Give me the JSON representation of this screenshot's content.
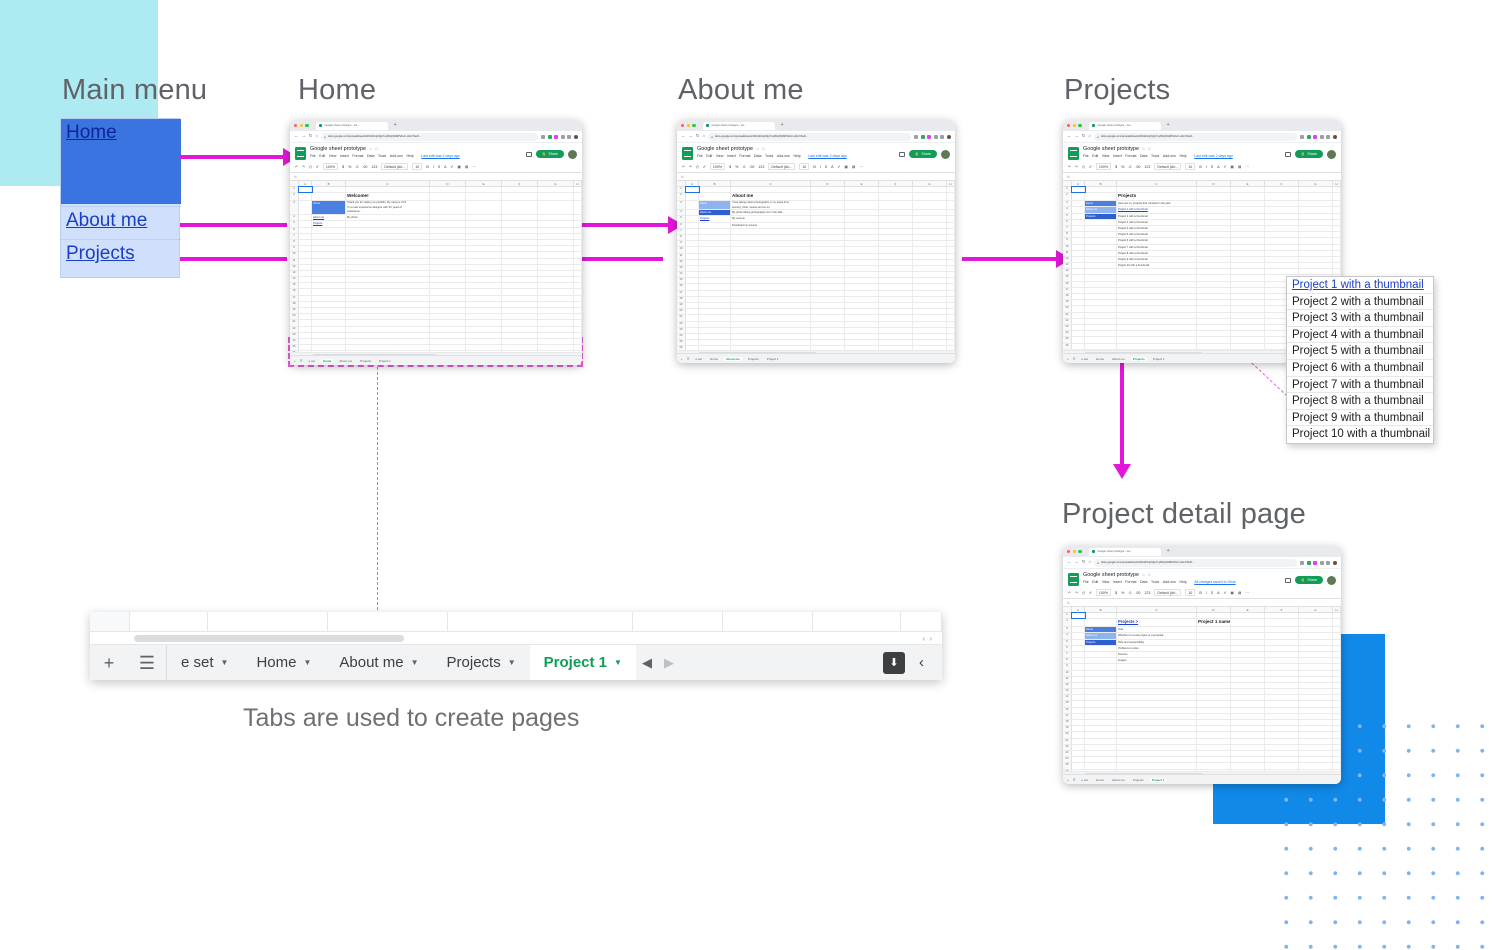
{
  "headings": {
    "main_menu": "Main menu",
    "home": "Home",
    "about_me": "About me",
    "projects": "Projects",
    "project_detail": "Project detail page"
  },
  "caption": {
    "tabs": "Tabs are used to create pages"
  },
  "main_menu": {
    "items": [
      {
        "label": "Home",
        "state": "selected"
      },
      {
        "label": "About me",
        "state": "normal"
      },
      {
        "label": "Projects",
        "state": "normal"
      }
    ]
  },
  "browser": {
    "tab_title": "Google sheet prototype - Go...",
    "new_tab": "+",
    "back": "←",
    "forward": "→",
    "reload": "↻",
    "home": "⌂",
    "lock": "●",
    "url": "docs.google.com/spreadsheets/d/1hkDmj0Ujp7uy8GQNx6RVAvC-s0mXbeD...",
    "star": "☆",
    "menu": "⋮"
  },
  "doc": {
    "title": "Google sheet prototype",
    "star": "☆",
    "drive": "□",
    "menus": [
      "File",
      "Edit",
      "View",
      "Insert",
      "Format",
      "Data",
      "Tools",
      "Add-ons",
      "Help"
    ],
    "last_edit": "Last edit was 2 days ago",
    "last_edit_saved": "All changes saved to Drive",
    "share": "Share",
    "share_icon": "🔒",
    "comment_icon": "comment",
    "toolbar": {
      "undo": "↶",
      "redo": "↷",
      "print": "⎙",
      "paint": "✐",
      "zoom": "100%",
      "currency": "$",
      "percent": "%",
      "decimal_dec": ".0",
      "decimal_inc": ".00",
      "format": "123",
      "font": "Default (Ari...",
      "font_size": "10",
      "bold": "B",
      "italic": "I",
      "strike": "S",
      "text_color": "A",
      "fill": "✐",
      "borders": "▦",
      "merge": "▤",
      "more": "⋯",
      "collapse": "⌃"
    },
    "formula_bar": "fx"
  },
  "sheet_tabs": {
    "add": "+",
    "all_sheets": "☰",
    "tabs": [
      "e set",
      "Home",
      "About me",
      "Projects",
      "Project 1"
    ],
    "active": "Project 1",
    "prev": "◀",
    "next": "▶",
    "all_sheets_button": "⬇",
    "collapse": "‹",
    "truncated_first": "e set"
  },
  "home_page": {
    "heading": "Welcome!",
    "nav": [
      "Home",
      "About me",
      "Projects"
    ],
    "body": [
      "Thank you for visiting my portfolio. My name is XYZ.",
      "I'm a user experience designer with XX years of",
      "experience."
    ],
    "photo_label": "My photo"
  },
  "about_page": {
    "heading": "About me",
    "nav": [
      "Home",
      "About me",
      "Projects"
    ],
    "rows": [
      "I love taking nature photography in my spare time,",
      "scenery, birds, insects and so on.",
      "My photo taking photography out in the wild...",
      "My resume",
      "Download my resume"
    ]
  },
  "projects_page": {
    "heading": "Projects",
    "nav": [
      "Home",
      "About me",
      "Projects"
    ],
    "intro": "Here are my projects that I worked in the past",
    "items": [
      "Project 1 with a thumbnail",
      "Project 2 with a thumbnail",
      "Project 3 with a thumbnail",
      "Project 4 with a thumbnail",
      "Project 5 with a thumbnail",
      "Project 6 with a thumbnail",
      "Project 7 with a thumbnail",
      "Project 8 with a thumbnail",
      "Project 9 with a thumbnail",
      "Project 10 with a thumbnail"
    ]
  },
  "project_list_popup": {
    "items": [
      "Project 1 with a thumbnail",
      "Project 2 with a thumbnail",
      "Project 3 with a thumbnail",
      "Project 4 with a thumbnail",
      "Project 5 with a thumbnail",
      "Project 6 with a thumbnail",
      "Project 7 with a thumbnail",
      "Project 8 with a thumbnail",
      "Project 9 with a thumbnail",
      "Project 10 with a thumbnail"
    ]
  },
  "detail_page": {
    "breadcrumb": "Projects >",
    "title": "Project 1 name",
    "nav": [
      "Home",
      "About me",
      "Projects"
    ],
    "rows": [
      "Year",
      "Whether it's a real project or a proposal",
      "Role and responsibility",
      "Problems to solve",
      "Process",
      "Images"
    ]
  },
  "grid": {
    "columns": [
      "A",
      "B",
      "C",
      "D",
      "E",
      "F",
      "G",
      "H"
    ],
    "row_numbers": [
      "1",
      "2",
      "3",
      "4",
      "5",
      "6",
      "7",
      "8",
      "9",
      "10",
      "11",
      "12",
      "13",
      "14",
      "15",
      "16",
      "17",
      "18",
      "19",
      "20",
      "21",
      "22",
      "23",
      "24",
      "25",
      "26"
    ]
  },
  "colors": {
    "accent_magenta": "#e217d8",
    "dashed_pink": "#e85fdc",
    "menu_selected_blue": "#3a74e0",
    "menu_blue": "#cfdffc",
    "link_blue": "#1a3fc4",
    "cyan_block": "#aeeaf2",
    "blue_block": "#1089e8",
    "dots_blue": "#7fb6f0",
    "sheets_green": "#0f9d58",
    "heading_gray": "#5f6368"
  }
}
